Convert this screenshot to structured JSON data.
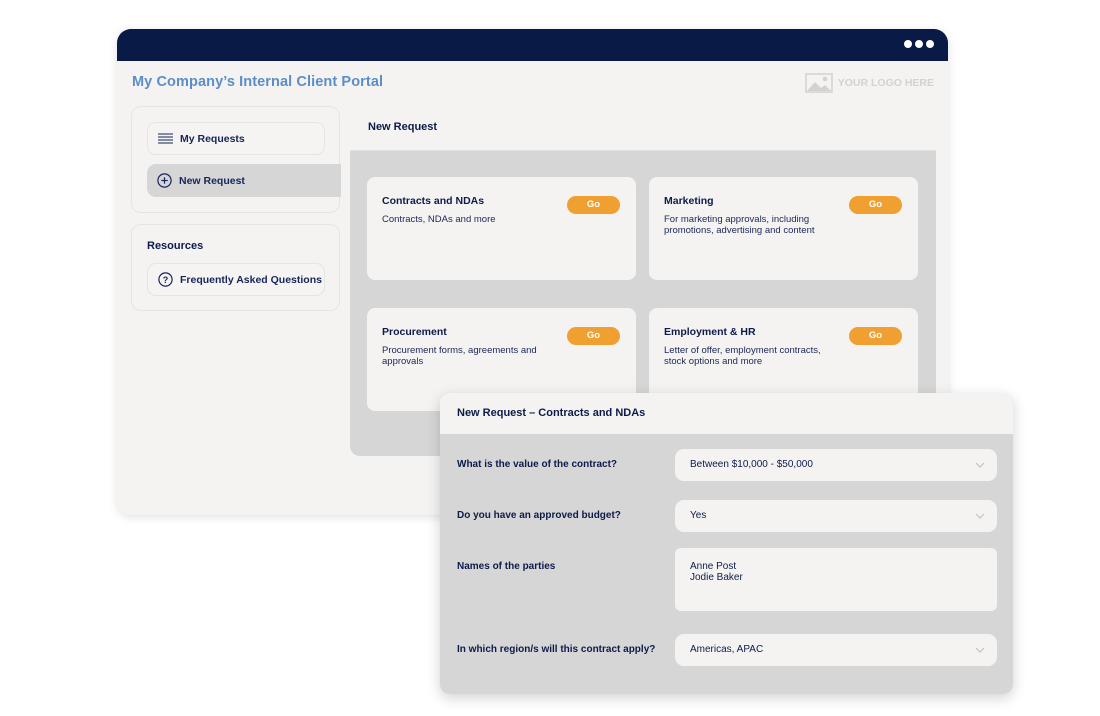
{
  "window": {
    "menu_icon": "more-dots-icon",
    "portal_title": "My Company’s Internal Client Portal",
    "logo_text": "YOUR LOGO HERE",
    "logo_icon": "image-placeholder-icon"
  },
  "sidebar": {
    "nav_items": [
      {
        "label": "My Requests",
        "icon": "list-icon",
        "active": false
      },
      {
        "label": "New Request",
        "icon": "plus-circle-icon",
        "active": true
      }
    ],
    "resources": {
      "title": "Resources",
      "items": [
        {
          "label": "Frequently Asked Questions",
          "icon": "question-circle-icon"
        }
      ]
    }
  },
  "main": {
    "title": "New Request",
    "categories": [
      {
        "title": "Contracts and NDAs",
        "description": "Contracts, NDAs and more",
        "button": "Go"
      },
      {
        "title": "Marketing",
        "description": "For marketing approvals, including promotions, advertising and content",
        "button": "Go"
      },
      {
        "title": "Procurement",
        "description": "Procurement forms, agreements and approvals",
        "button": "Go"
      },
      {
        "title": "Employment & HR",
        "description": "Letter of offer, employment contracts, stock options and more",
        "button": "Go"
      }
    ]
  },
  "form": {
    "title": "New Request – Contracts and NDAs",
    "questions": [
      {
        "label": "What is the value of the contract?",
        "type": "select",
        "value": "Between $10,000 - $50,000"
      },
      {
        "label": "Do you have an approved budget?",
        "type": "select",
        "value": "Yes"
      },
      {
        "label": "Names of the parties",
        "type": "textarea",
        "value": "Anne Post\nJodie Baker"
      },
      {
        "label": "In which region/s will this contract apply?",
        "type": "select",
        "value": "Americas, APAC"
      }
    ]
  },
  "colors": {
    "titlebar": "#081a45",
    "portal_title": "#5b8ec9",
    "accent_button": "#f0a030",
    "text_primary": "#0d1b4b",
    "panel_bg": "#d6d6d6",
    "card_bg": "#f4f3f1"
  }
}
